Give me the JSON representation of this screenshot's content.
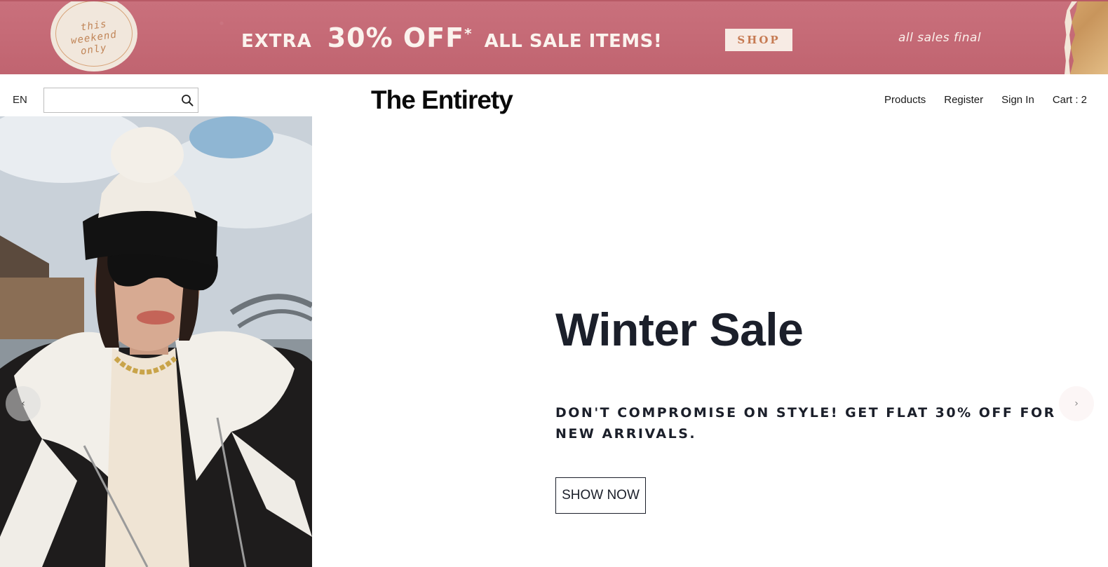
{
  "promo": {
    "stamp_line1": "this",
    "stamp_line2": "weekend",
    "stamp_line3": "only",
    "extra": "EXTRA",
    "percent": "30% OFF",
    "asterisk": "*",
    "items": "ALL SALE ITEMS!",
    "shop_label": "SHOP",
    "final_note": "all sales final",
    "colors": {
      "banner": "#c56a76",
      "stamp": "#f1e7dc",
      "shop_text": "#c67a52"
    }
  },
  "header": {
    "language": "EN",
    "search": {
      "value": "",
      "placeholder": ""
    },
    "logo": "The Entirety",
    "nav": {
      "products": "Products",
      "register": "Register",
      "sign_in": "Sign In",
      "cart": "Cart : 2"
    }
  },
  "hero": {
    "title": "Winter Sale",
    "subtitle": "DON'T COMPROMISE ON STYLE! GET FLAT 30% OFF FOR NEW ARRIVALS.",
    "button": "SHOW NOW",
    "prev_arrow": "‹",
    "next_arrow": "›",
    "text_color": "#1b1f2a"
  }
}
